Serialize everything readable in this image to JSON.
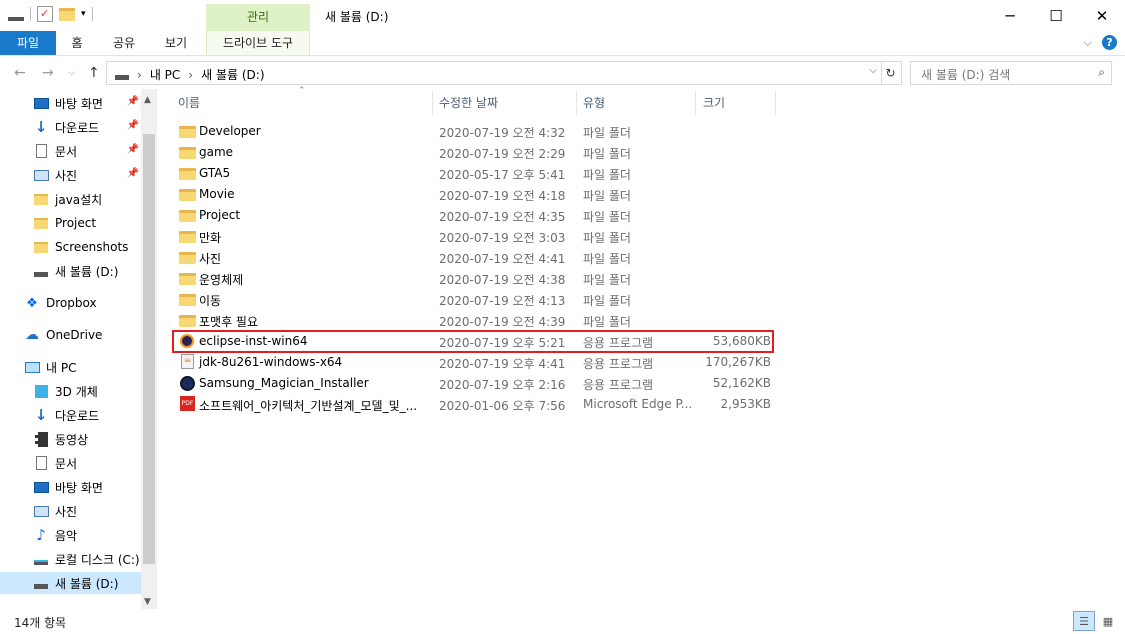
{
  "window": {
    "title": "새 볼륨 (D:)",
    "context_tab_group": "관리"
  },
  "ribbon": {
    "tabs": [
      {
        "label": "파일"
      },
      {
        "label": "홈"
      },
      {
        "label": "공유"
      },
      {
        "label": "보기"
      },
      {
        "label": "드라이브 도구"
      }
    ]
  },
  "address": {
    "crumbs": [
      "내 PC",
      "새 볼륨 (D:)"
    ],
    "search_placeholder": "새 볼륨 (D:) 검색"
  },
  "nav": {
    "items": [
      {
        "label": "바탕 화면",
        "icon": "desktop-icon",
        "pinned": true
      },
      {
        "label": "다운로드",
        "icon": "download-icon",
        "pinned": true
      },
      {
        "label": "문서",
        "icon": "document-icon",
        "pinned": true
      },
      {
        "label": "사진",
        "icon": "picture-icon",
        "pinned": true
      },
      {
        "label": "java설치",
        "icon": "folder-icon",
        "pinned": false
      },
      {
        "label": "Project",
        "icon": "folder-icon",
        "pinned": false
      },
      {
        "label": "Screenshots",
        "icon": "folder-icon",
        "pinned": false
      },
      {
        "label": "새 볼륨 (D:)",
        "icon": "drive-icon",
        "pinned": false
      },
      {
        "label": "Dropbox",
        "icon": "dropbox-icon",
        "pinned": false
      },
      {
        "label": "OneDrive",
        "icon": "cloud-icon",
        "pinned": false
      },
      {
        "label": "내 PC",
        "icon": "pc-icon",
        "pinned": false
      },
      {
        "label": "3D 개체",
        "icon": "cube-icon",
        "pinned": false
      },
      {
        "label": "다운로드",
        "icon": "download-icon",
        "pinned": false
      },
      {
        "label": "동영상",
        "icon": "video-icon",
        "pinned": false
      },
      {
        "label": "문서",
        "icon": "document-icon",
        "pinned": false
      },
      {
        "label": "바탕 화면",
        "icon": "desktop-icon",
        "pinned": false
      },
      {
        "label": "사진",
        "icon": "picture-icon",
        "pinned": false
      },
      {
        "label": "음악",
        "icon": "music-icon",
        "pinned": false
      },
      {
        "label": "로컬 디스크 (C:)",
        "icon": "drive-icon",
        "pinned": false
      },
      {
        "label": "새 볼륨 (D:)",
        "icon": "drive-icon",
        "pinned": false,
        "selected": true
      }
    ]
  },
  "columns": {
    "name": "이름",
    "date": "수정한 날짜",
    "type": "유형",
    "size": "크기"
  },
  "files": [
    {
      "name": "Developer",
      "date": "2020-07-19 오전 4:32",
      "type": "파일 폴더",
      "size": "",
      "icon": "folder-icon"
    },
    {
      "name": "game",
      "date": "2020-07-19 오전 2:29",
      "type": "파일 폴더",
      "size": "",
      "icon": "folder-icon"
    },
    {
      "name": "GTA5",
      "date": "2020-05-17 오후 5:41",
      "type": "파일 폴더",
      "size": "",
      "icon": "folder-icon"
    },
    {
      "name": "Movie",
      "date": "2020-07-19 오전 4:18",
      "type": "파일 폴더",
      "size": "",
      "icon": "folder-icon"
    },
    {
      "name": "Project",
      "date": "2020-07-19 오전 4:35",
      "type": "파일 폴더",
      "size": "",
      "icon": "folder-icon"
    },
    {
      "name": "만화",
      "date": "2020-07-19 오전 3:03",
      "type": "파일 폴더",
      "size": "",
      "icon": "folder-icon"
    },
    {
      "name": "사진",
      "date": "2020-07-19 오전 4:41",
      "type": "파일 폴더",
      "size": "",
      "icon": "folder-icon"
    },
    {
      "name": "운영체제",
      "date": "2020-07-19 오전 4:38",
      "type": "파일 폴더",
      "size": "",
      "icon": "folder-icon"
    },
    {
      "name": "이동",
      "date": "2020-07-19 오전 4:13",
      "type": "파일 폴더",
      "size": "",
      "icon": "folder-icon"
    },
    {
      "name": "포맷후 필요",
      "date": "2020-07-19 오전 4:39",
      "type": "파일 폴더",
      "size": "",
      "icon": "folder-icon"
    },
    {
      "name": "eclipse-inst-win64",
      "date": "2020-07-19 오후 5:21",
      "type": "응용 프로그램",
      "size": "53,680KB",
      "icon": "eclipse-icon",
      "highlight": true
    },
    {
      "name": "jdk-8u261-windows-x64",
      "date": "2020-07-19 오후 4:41",
      "type": "응용 프로그램",
      "size": "170,267KB",
      "icon": "java-icon"
    },
    {
      "name": "Samsung_Magician_Installer",
      "date": "2020-07-19 오후 2:16",
      "type": "응용 프로그램",
      "size": "52,162KB",
      "icon": "samsung-icon"
    },
    {
      "name": "소프트웨어_아키텍처_기반설계_모델_및_...",
      "date": "2020-01-06 오후 7:56",
      "type": "Microsoft Edge P...",
      "size": "2,953KB",
      "icon": "pdf-icon"
    }
  ],
  "status": {
    "count": "14개 항목"
  },
  "colors": {
    "accent": "#1979ca",
    "selected_bg": "#cce8ff",
    "highlight_border": "#e02020",
    "context_tab": "#dff2c7"
  }
}
